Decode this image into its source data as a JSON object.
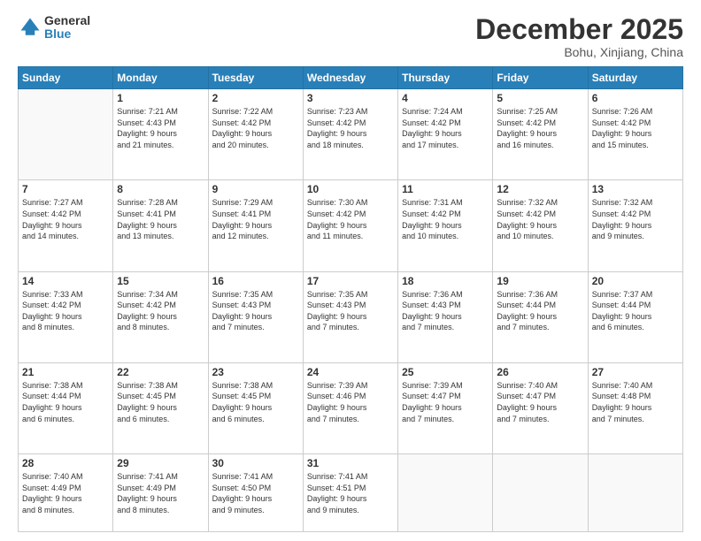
{
  "logo": {
    "general": "General",
    "blue": "Blue"
  },
  "header": {
    "month": "December 2025",
    "location": "Bohu, Xinjiang, China"
  },
  "weekdays": [
    "Sunday",
    "Monday",
    "Tuesday",
    "Wednesday",
    "Thursday",
    "Friday",
    "Saturday"
  ],
  "weeks": [
    [
      {
        "day": "",
        "info": ""
      },
      {
        "day": "1",
        "info": "Sunrise: 7:21 AM\nSunset: 4:43 PM\nDaylight: 9 hours\nand 21 minutes."
      },
      {
        "day": "2",
        "info": "Sunrise: 7:22 AM\nSunset: 4:42 PM\nDaylight: 9 hours\nand 20 minutes."
      },
      {
        "day": "3",
        "info": "Sunrise: 7:23 AM\nSunset: 4:42 PM\nDaylight: 9 hours\nand 18 minutes."
      },
      {
        "day": "4",
        "info": "Sunrise: 7:24 AM\nSunset: 4:42 PM\nDaylight: 9 hours\nand 17 minutes."
      },
      {
        "day": "5",
        "info": "Sunrise: 7:25 AM\nSunset: 4:42 PM\nDaylight: 9 hours\nand 16 minutes."
      },
      {
        "day": "6",
        "info": "Sunrise: 7:26 AM\nSunset: 4:42 PM\nDaylight: 9 hours\nand 15 minutes."
      }
    ],
    [
      {
        "day": "7",
        "info": "Sunrise: 7:27 AM\nSunset: 4:42 PM\nDaylight: 9 hours\nand 14 minutes."
      },
      {
        "day": "8",
        "info": "Sunrise: 7:28 AM\nSunset: 4:41 PM\nDaylight: 9 hours\nand 13 minutes."
      },
      {
        "day": "9",
        "info": "Sunrise: 7:29 AM\nSunset: 4:41 PM\nDaylight: 9 hours\nand 12 minutes."
      },
      {
        "day": "10",
        "info": "Sunrise: 7:30 AM\nSunset: 4:42 PM\nDaylight: 9 hours\nand 11 minutes."
      },
      {
        "day": "11",
        "info": "Sunrise: 7:31 AM\nSunset: 4:42 PM\nDaylight: 9 hours\nand 10 minutes."
      },
      {
        "day": "12",
        "info": "Sunrise: 7:32 AM\nSunset: 4:42 PM\nDaylight: 9 hours\nand 10 minutes."
      },
      {
        "day": "13",
        "info": "Sunrise: 7:32 AM\nSunset: 4:42 PM\nDaylight: 9 hours\nand 9 minutes."
      }
    ],
    [
      {
        "day": "14",
        "info": "Sunrise: 7:33 AM\nSunset: 4:42 PM\nDaylight: 9 hours\nand 8 minutes."
      },
      {
        "day": "15",
        "info": "Sunrise: 7:34 AM\nSunset: 4:42 PM\nDaylight: 9 hours\nand 8 minutes."
      },
      {
        "day": "16",
        "info": "Sunrise: 7:35 AM\nSunset: 4:43 PM\nDaylight: 9 hours\nand 7 minutes."
      },
      {
        "day": "17",
        "info": "Sunrise: 7:35 AM\nSunset: 4:43 PM\nDaylight: 9 hours\nand 7 minutes."
      },
      {
        "day": "18",
        "info": "Sunrise: 7:36 AM\nSunset: 4:43 PM\nDaylight: 9 hours\nand 7 minutes."
      },
      {
        "day": "19",
        "info": "Sunrise: 7:36 AM\nSunset: 4:44 PM\nDaylight: 9 hours\nand 7 minutes."
      },
      {
        "day": "20",
        "info": "Sunrise: 7:37 AM\nSunset: 4:44 PM\nDaylight: 9 hours\nand 6 minutes."
      }
    ],
    [
      {
        "day": "21",
        "info": "Sunrise: 7:38 AM\nSunset: 4:44 PM\nDaylight: 9 hours\nand 6 minutes."
      },
      {
        "day": "22",
        "info": "Sunrise: 7:38 AM\nSunset: 4:45 PM\nDaylight: 9 hours\nand 6 minutes."
      },
      {
        "day": "23",
        "info": "Sunrise: 7:38 AM\nSunset: 4:45 PM\nDaylight: 9 hours\nand 6 minutes."
      },
      {
        "day": "24",
        "info": "Sunrise: 7:39 AM\nSunset: 4:46 PM\nDaylight: 9 hours\nand 7 minutes."
      },
      {
        "day": "25",
        "info": "Sunrise: 7:39 AM\nSunset: 4:47 PM\nDaylight: 9 hours\nand 7 minutes."
      },
      {
        "day": "26",
        "info": "Sunrise: 7:40 AM\nSunset: 4:47 PM\nDaylight: 9 hours\nand 7 minutes."
      },
      {
        "day": "27",
        "info": "Sunrise: 7:40 AM\nSunset: 4:48 PM\nDaylight: 9 hours\nand 7 minutes."
      }
    ],
    [
      {
        "day": "28",
        "info": "Sunrise: 7:40 AM\nSunset: 4:49 PM\nDaylight: 9 hours\nand 8 minutes."
      },
      {
        "day": "29",
        "info": "Sunrise: 7:41 AM\nSunset: 4:49 PM\nDaylight: 9 hours\nand 8 minutes."
      },
      {
        "day": "30",
        "info": "Sunrise: 7:41 AM\nSunset: 4:50 PM\nDaylight: 9 hours\nand 9 minutes."
      },
      {
        "day": "31",
        "info": "Sunrise: 7:41 AM\nSunset: 4:51 PM\nDaylight: 9 hours\nand 9 minutes."
      },
      {
        "day": "",
        "info": ""
      },
      {
        "day": "",
        "info": ""
      },
      {
        "day": "",
        "info": ""
      }
    ]
  ]
}
